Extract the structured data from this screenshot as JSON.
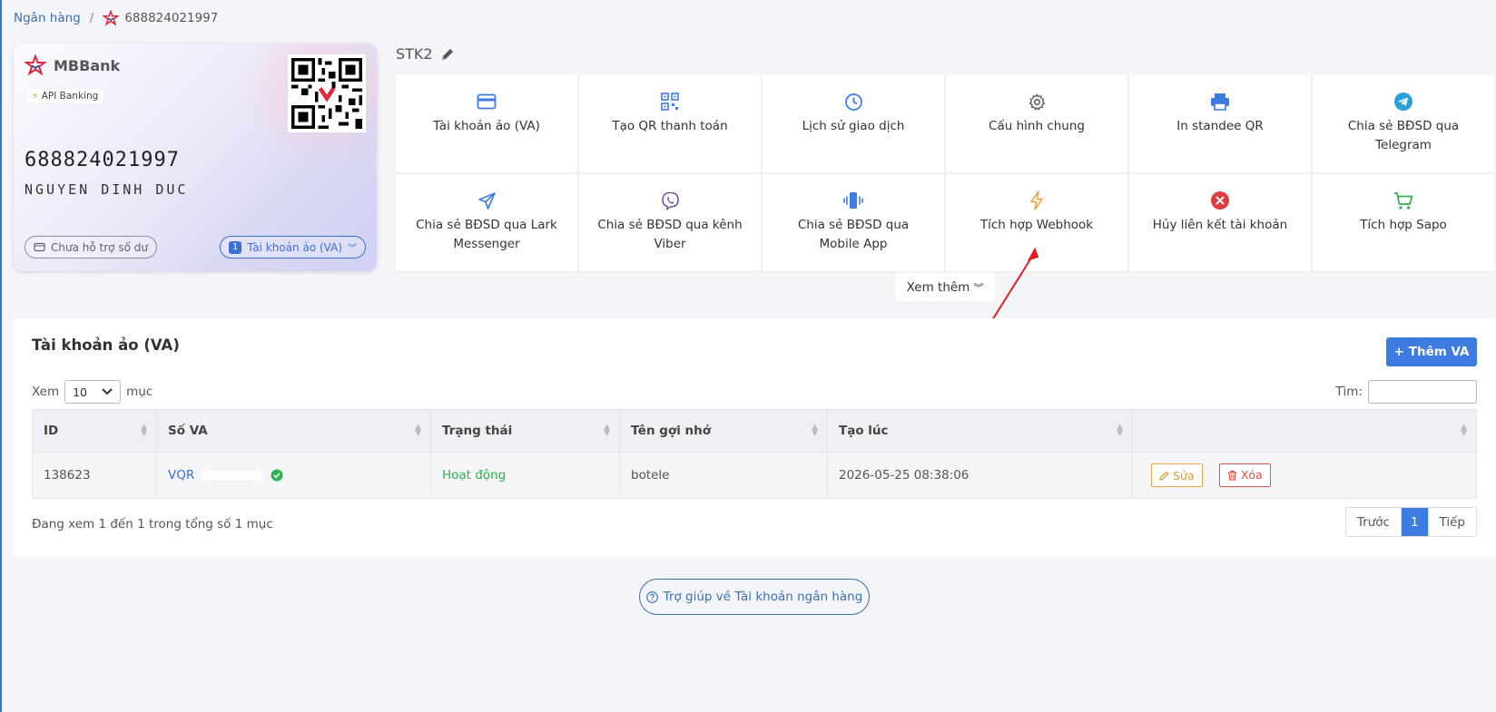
{
  "breadcrumb": {
    "root": "Ngân hàng",
    "separator": "/",
    "current": "688824021997"
  },
  "card": {
    "bank_name": "MBBank",
    "api_badge": "API Banking",
    "account_number": "688824021997",
    "holder_name": "NGUYEN DINH DUC",
    "balance_label": "Chưa hỗ trợ số dư",
    "va_count": "1",
    "va_label": "Tài khoản ảo (VA)"
  },
  "account_label": "STK2",
  "features": [
    {
      "label": "Tài khoản ảo (VA)",
      "icon": "card-icon"
    },
    {
      "label": "Tạo QR thanh toán",
      "icon": "qr-icon"
    },
    {
      "label": "Lịch sử giao dịch",
      "icon": "history-icon"
    },
    {
      "label": "Cấu hình chung",
      "icon": "gear-icon"
    },
    {
      "label": "In standee QR",
      "icon": "printer-icon"
    },
    {
      "label": "Chia sẻ BĐSD qua Telegram",
      "icon": "telegram-icon"
    },
    {
      "label": "Chia sẻ BĐSD qua Lark Messenger",
      "icon": "send-icon"
    },
    {
      "label": "Chia sẻ BĐSD qua kênh Viber",
      "icon": "viber-icon"
    },
    {
      "label": "Chia sẻ BĐSD qua Mobile App",
      "icon": "mobile-icon"
    },
    {
      "label": "Tích hợp Webhook",
      "icon": "bolt-icon"
    },
    {
      "label": "Hủy liên kết tài khoản",
      "icon": "close-circle-icon"
    },
    {
      "label": "Tích hợp Sapo",
      "icon": "cart-icon"
    }
  ],
  "see_more": "Xem thêm",
  "va_panel": {
    "title": "Tài khoản ảo (VA)",
    "add_button": "Thêm VA",
    "show_label": "Xem",
    "page_size": "10",
    "entries_label": "mục",
    "search_label": "Tìm:",
    "columns": [
      "ID",
      "Số VA",
      "Trạng thái",
      "Tên gợi nhớ",
      "Tạo lúc",
      ""
    ],
    "rows": [
      {
        "id": "138623",
        "va": "VQR",
        "status": "Hoạt động",
        "nickname": "botele",
        "created": "2026-05-25 08:38:06",
        "edit": "Sửa",
        "delete": "Xóa"
      }
    ],
    "info": "Đang xem 1 đến 1 trong tổng số 1 mục",
    "pager": {
      "prev": "Trước",
      "page": "1",
      "next": "Tiếp"
    }
  },
  "help_button": "Trợ giúp về Tài khoản ngân hàng",
  "colors": {
    "accent": "#3d7be0",
    "brand": "#e4263a",
    "success": "#2fb14f",
    "danger": "#d9534f",
    "warning": "#e09b35"
  }
}
